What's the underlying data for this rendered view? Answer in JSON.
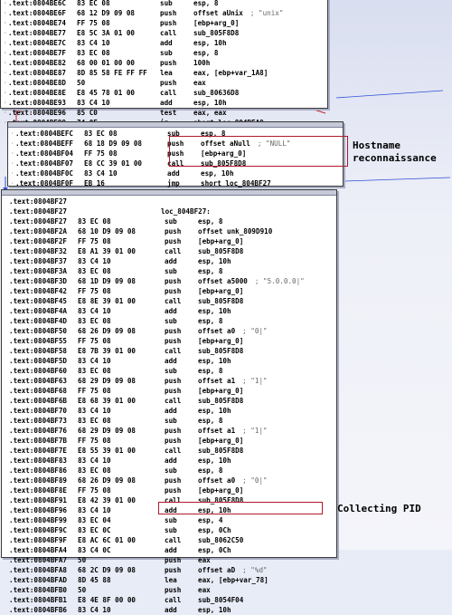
{
  "panel1": {
    "rows": [
      {
        "addr": ".text:0804BE6C",
        "bytes": "83 EC 08",
        "mn": "sub",
        "op": "esp, 8",
        "cm": ""
      },
      {
        "addr": ".text:0804BE6F",
        "bytes": "68 12 D9 09 08",
        "mn": "push",
        "op": "offset aUnix",
        "cm": "; \"unix\""
      },
      {
        "addr": ".text:0804BE74",
        "bytes": "FF 75 08",
        "mn": "push",
        "op": "[ebp+arg_0]",
        "cm": ""
      },
      {
        "addr": ".text:0804BE77",
        "bytes": "E8 5C 3A 01 00",
        "mn": "call",
        "op": "sub_805F8D8",
        "cm": ""
      },
      {
        "addr": ".text:0804BE7C",
        "bytes": "83 C4 10",
        "mn": "add",
        "op": "esp, 10h",
        "cm": ""
      },
      {
        "addr": ".text:0804BE7F",
        "bytes": "83 EC 08",
        "mn": "sub",
        "op": "esp, 8",
        "cm": ""
      },
      {
        "addr": ".text:0804BE82",
        "bytes": "68 00 01 00 00",
        "mn": "push",
        "op": "100h",
        "cm": ""
      },
      {
        "addr": ".text:0804BE87",
        "bytes": "8D 85 58 FE FF FF",
        "mn": "lea",
        "op": "eax, [ebp+var_1A8]",
        "cm": ""
      },
      {
        "addr": ".text:0804BE8D",
        "bytes": "50",
        "mn": "push",
        "op": "eax",
        "cm": ""
      },
      {
        "addr": ".text:0804BE8E",
        "bytes": "E8 45 78 01 00",
        "mn": "call",
        "op": "sub_80636D8",
        "cm": ""
      },
      {
        "addr": ".text:0804BE93",
        "bytes": "83 C4 10",
        "mn": "add",
        "op": "esp, 10h",
        "cm": ""
      },
      {
        "addr": ".text:0804BE96",
        "bytes": "85 C0",
        "mn": "test",
        "op": "eax, eax",
        "cm": ""
      },
      {
        "addr": ".text:0804BE98",
        "bytes": "74 0F",
        "mn": "jz",
        "op": "short loc_804BEA9",
        "cm": ""
      }
    ]
  },
  "panel2": {
    "rows": [
      {
        "addr": ".text:0804BEFC",
        "bytes": "83 EC 08",
        "mn": "sub",
        "op": "esp, 8",
        "cm": ""
      },
      {
        "addr": ".text:0804BEFF",
        "bytes": "68 18 D9 09 08",
        "mn": "push",
        "op": "offset aNull",
        "cm": "; \"NULL\""
      },
      {
        "addr": ".text:0804BF04",
        "bytes": "FF 75 08",
        "mn": "push",
        "op": "[ebp+arg_0]",
        "cm": ""
      },
      {
        "addr": ".text:0804BF07",
        "bytes": "E8 CC 39 01 00",
        "mn": "call",
        "op": "sub_805F8D8",
        "cm": ""
      },
      {
        "addr": ".text:0804BF0C",
        "bytes": "83 C4 10",
        "mn": "add",
        "op": "esp, 10h",
        "cm": ""
      },
      {
        "addr": ".text:0804BF0F",
        "bytes": "EB 16",
        "mn": "jmp",
        "op": "short loc_804BF27",
        "cm": ""
      }
    ]
  },
  "panel3": {
    "rows": [
      {
        "addr": ".text:0804BF27",
        "bytes": "",
        "mn": "",
        "op": "",
        "cm": "",
        "label": ""
      },
      {
        "addr": ".text:0804BF27",
        "bytes": "",
        "mn": "",
        "op": "",
        "cm": "",
        "label": "loc_804BF27:"
      },
      {
        "addr": ".text:0804BF27",
        "bytes": "83 EC 08",
        "mn": "sub",
        "op": "esp, 8",
        "cm": ""
      },
      {
        "addr": ".text:0804BF2A",
        "bytes": "68 10 D9 09 08",
        "mn": "push",
        "op": "offset unk_809D910",
        "cm": ""
      },
      {
        "addr": ".text:0804BF2F",
        "bytes": "FF 75 08",
        "mn": "push",
        "op": "[ebp+arg_0]",
        "cm": ""
      },
      {
        "addr": ".text:0804BF32",
        "bytes": "E8 A1 39 01 00",
        "mn": "call",
        "op": "sub_805F8D8",
        "cm": ""
      },
      {
        "addr": ".text:0804BF37",
        "bytes": "83 C4 10",
        "mn": "add",
        "op": "esp, 10h",
        "cm": ""
      },
      {
        "addr": ".text:0804BF3A",
        "bytes": "83 EC 08",
        "mn": "sub",
        "op": "esp, 8",
        "cm": ""
      },
      {
        "addr": ".text:0804BF3D",
        "bytes": "68 1D D9 09 08",
        "mn": "push",
        "op": "offset a5000",
        "cm": "; \"5.0.0.0|\""
      },
      {
        "addr": ".text:0804BF42",
        "bytes": "FF 75 08",
        "mn": "push",
        "op": "[ebp+arg_0]",
        "cm": ""
      },
      {
        "addr": ".text:0804BF45",
        "bytes": "E8 8E 39 01 00",
        "mn": "call",
        "op": "sub_805F8D8",
        "cm": ""
      },
      {
        "addr": ".text:0804BF4A",
        "bytes": "83 C4 10",
        "mn": "add",
        "op": "esp, 10h",
        "cm": ""
      },
      {
        "addr": ".text:0804BF4D",
        "bytes": "83 EC 08",
        "mn": "sub",
        "op": "esp, 8",
        "cm": ""
      },
      {
        "addr": ".text:0804BF50",
        "bytes": "68 26 D9 09 08",
        "mn": "push",
        "op": "offset a0",
        "cm": "; \"0|\""
      },
      {
        "addr": ".text:0804BF55",
        "bytes": "FF 75 08",
        "mn": "push",
        "op": "[ebp+arg_0]",
        "cm": ""
      },
      {
        "addr": ".text:0804BF58",
        "bytes": "E8 7B 39 01 00",
        "mn": "call",
        "op": "sub_805F8D8",
        "cm": ""
      },
      {
        "addr": ".text:0804BF5D",
        "bytes": "83 C4 10",
        "mn": "add",
        "op": "esp, 10h",
        "cm": ""
      },
      {
        "addr": ".text:0804BF60",
        "bytes": "83 EC 08",
        "mn": "sub",
        "op": "esp, 8",
        "cm": ""
      },
      {
        "addr": ".text:0804BF63",
        "bytes": "68 29 D9 09 08",
        "mn": "push",
        "op": "offset a1",
        "cm": "; \"1|\""
      },
      {
        "addr": ".text:0804BF68",
        "bytes": "FF 75 08",
        "mn": "push",
        "op": "[ebp+arg_0]",
        "cm": ""
      },
      {
        "addr": ".text:0804BF6B",
        "bytes": "E8 68 39 01 00",
        "mn": "call",
        "op": "sub_805F8D8",
        "cm": ""
      },
      {
        "addr": ".text:0804BF70",
        "bytes": "83 C4 10",
        "mn": "add",
        "op": "esp, 10h",
        "cm": ""
      },
      {
        "addr": ".text:0804BF73",
        "bytes": "83 EC 08",
        "mn": "sub",
        "op": "esp, 8",
        "cm": ""
      },
      {
        "addr": ".text:0804BF76",
        "bytes": "68 29 D9 09 08",
        "mn": "push",
        "op": "offset a1",
        "cm": "; \"1|\""
      },
      {
        "addr": ".text:0804BF7B",
        "bytes": "FF 75 08",
        "mn": "push",
        "op": "[ebp+arg_0]",
        "cm": ""
      },
      {
        "addr": ".text:0804BF7E",
        "bytes": "E8 55 39 01 00",
        "mn": "call",
        "op": "sub_805F8D8",
        "cm": ""
      },
      {
        "addr": ".text:0804BF83",
        "bytes": "83 C4 10",
        "mn": "add",
        "op": "esp, 10h",
        "cm": ""
      },
      {
        "addr": ".text:0804BF86",
        "bytes": "83 EC 08",
        "mn": "sub",
        "op": "esp, 8",
        "cm": ""
      },
      {
        "addr": ".text:0804BF89",
        "bytes": "68 26 D9 09 08",
        "mn": "push",
        "op": "offset a0",
        "cm": "; \"0|\""
      },
      {
        "addr": ".text:0804BF8E",
        "bytes": "FF 75 08",
        "mn": "push",
        "op": "[ebp+arg_0]",
        "cm": ""
      },
      {
        "addr": ".text:0804BF91",
        "bytes": "E8 42 39 01 00",
        "mn": "call",
        "op": "sub_805F8D8",
        "cm": ""
      },
      {
        "addr": ".text:0804BF96",
        "bytes": "83 C4 10",
        "mn": "add",
        "op": "esp, 10h",
        "cm": ""
      },
      {
        "addr": ".text:0804BF99",
        "bytes": "83 EC 04",
        "mn": "sub",
        "op": "esp, 4",
        "cm": ""
      },
      {
        "addr": ".text:0804BF9C",
        "bytes": "83 EC 0C",
        "mn": "sub",
        "op": "esp, 0Ch",
        "cm": ""
      },
      {
        "addr": ".text:0804BF9F",
        "bytes": "E8 AC 6C 01 00",
        "mn": "call",
        "op": "sub_8062C50",
        "cm": ""
      },
      {
        "addr": ".text:0804BFA4",
        "bytes": "83 C4 0C",
        "mn": "add",
        "op": "esp, 0Ch",
        "cm": ""
      },
      {
        "addr": ".text:0804BFA7",
        "bytes": "50",
        "mn": "push",
        "op": "eax",
        "cm": ""
      },
      {
        "addr": ".text:0804BFA8",
        "bytes": "68 2C D9 09 08",
        "mn": "push",
        "op": "offset aD",
        "cm": "; \"%d\""
      },
      {
        "addr": ".text:0804BFAD",
        "bytes": "8D 45 88",
        "mn": "lea",
        "op": "eax, [ebp+var_78]",
        "cm": ""
      },
      {
        "addr": ".text:0804BFB0",
        "bytes": "50",
        "mn": "push",
        "op": "eax",
        "cm": ""
      },
      {
        "addr": ".text:0804BFB1",
        "bytes": "E8 4E 8F 00 00",
        "mn": "call",
        "op": "sub_8054F04",
        "cm": ""
      },
      {
        "addr": ".text:0804BFB6",
        "bytes": "83 C4 10",
        "mn": "add",
        "op": "esp, 10h",
        "cm": ""
      }
    ]
  },
  "annotations": {
    "hostname_line1": "Hostname",
    "hostname_line2": "reconnaissance",
    "pid": "Collecting PID"
  },
  "colors": {
    "highlight": "#b0182a",
    "arrow_red": "#c2272d",
    "arrow_blue": "#2e4fd4"
  }
}
